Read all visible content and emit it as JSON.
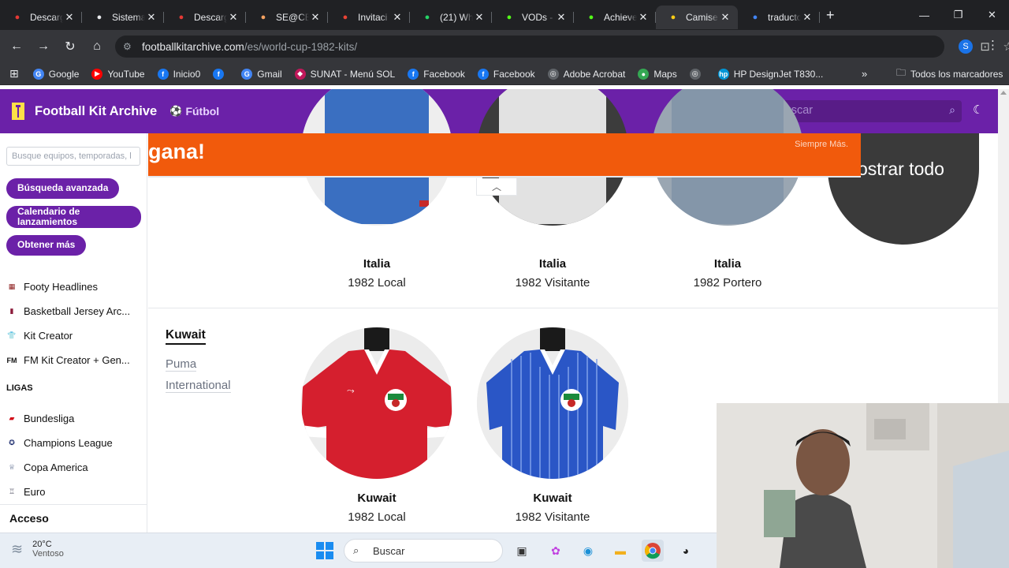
{
  "browser": {
    "tabs": [
      {
        "title": "Descarg",
        "icon": "heart-icon",
        "color": "#e53935"
      },
      {
        "title": "Sistema",
        "icon": "globe-icon",
        "color": "#e8eaed"
      },
      {
        "title": "Descarg",
        "icon": "heart-icon",
        "color": "#e53935"
      },
      {
        "title": "SE@CE",
        "icon": "circle-icon",
        "color": "#f4a261"
      },
      {
        "title": "Invitaci",
        "icon": "gmail-icon",
        "color": "#ea4335"
      },
      {
        "title": "(21) Wh",
        "icon": "whatsapp-icon",
        "color": "#25d366"
      },
      {
        "title": "VODs -",
        "icon": "kick-icon",
        "color": "#53fc18"
      },
      {
        "title": "Achieve",
        "icon": "kick-icon",
        "color": "#53fc18"
      },
      {
        "title": "Camise",
        "icon": "fka-icon",
        "color": "#facc15"
      },
      {
        "title": "traducto",
        "icon": "google-icon",
        "color": "#4285f4"
      }
    ],
    "url_domain": "footballkitarchive.com",
    "url_path": "/es/world-cup-1982-kits/",
    "profile_initial": "S",
    "bookmarks": [
      {
        "label": "Google",
        "color": "#4285f4",
        "glyph": "G"
      },
      {
        "label": "YouTube",
        "color": "#ff0000",
        "glyph": "▶"
      },
      {
        "label": "Inicio0",
        "color": "#1877f2",
        "glyph": "f"
      },
      {
        "label": "",
        "color": "#1877f2",
        "glyph": "f"
      },
      {
        "label": "Gmail",
        "color": "#4285f4",
        "glyph": "G"
      },
      {
        "label": "SUNAT - Menú SOL",
        "color": "#c2185b",
        "glyph": "◆"
      },
      {
        "label": "Facebook",
        "color": "#1877f2",
        "glyph": "f"
      },
      {
        "label": "Facebook",
        "color": "#1877f2",
        "glyph": "f"
      },
      {
        "label": "Adobe Acrobat",
        "color": "#5f6368",
        "glyph": "◎"
      },
      {
        "label": "Maps",
        "color": "#34a853",
        "glyph": "●"
      },
      {
        "label": "",
        "color": "#5f6368",
        "glyph": "◎"
      },
      {
        "label": "HP DesignJet T830...",
        "color": "#0096d6",
        "glyph": "hp"
      }
    ],
    "all_bookmarks": "Todos los marcadores"
  },
  "site": {
    "brand": "Football Kit Archive",
    "sport": "Fútbol",
    "search_placeholder": "Buscar",
    "sidebar": {
      "search_placeholder": "Busque equipos, temporadas, l",
      "advanced_search": "Búsqueda avanzada",
      "release_calendar": "Calendario de lanzamientos",
      "get_more": "Obtener más",
      "links": [
        {
          "label": "Footy Headlines",
          "icon": "footy-headlines-icon"
        },
        {
          "label": "Basketball Jersey Arc...",
          "icon": "basketball-jersey-icon"
        },
        {
          "label": "Kit Creator",
          "icon": "shirt-icon"
        },
        {
          "label": "FM Kit Creator + Gen...",
          "icon": "fm-icon"
        }
      ],
      "leagues_heading": "LIGAS",
      "leagues": [
        {
          "label": "Bundesliga",
          "icon": "bundesliga-icon"
        },
        {
          "label": "Champions League",
          "icon": "champions-league-icon"
        },
        {
          "label": "Copa America",
          "icon": "copa-america-icon"
        },
        {
          "label": "Euro",
          "icon": "euro-icon"
        }
      ],
      "login": "Acceso"
    },
    "ad": {
      "headline": "gana!",
      "brand_tagline": "Siempre Más."
    },
    "show_all": "ostrar todo",
    "italy_kits": [
      {
        "team": "Italia",
        "name": "1982 Local",
        "shirt_color": "#3a6fc1"
      },
      {
        "team": "Italia",
        "name": "1982 Visitante",
        "shirt_color": "#d8d8d8"
      },
      {
        "team": "Italia",
        "name": "1982 Portero",
        "shirt_color": "#8496a9"
      }
    ],
    "kuwait": {
      "country": "Kuwait",
      "manufacturer": "Puma",
      "manufacturer_line2": "International",
      "kits": [
        {
          "team": "Kuwait",
          "name": "1982 Local",
          "shirt_color": "#d51f2e"
        },
        {
          "team": "Kuwait",
          "name": "1982 Visitante",
          "shirt_color": "#2a56c6"
        }
      ]
    }
  },
  "taskbar": {
    "temperature": "20°C",
    "condition": "Ventoso",
    "search_placeholder": "Buscar"
  }
}
